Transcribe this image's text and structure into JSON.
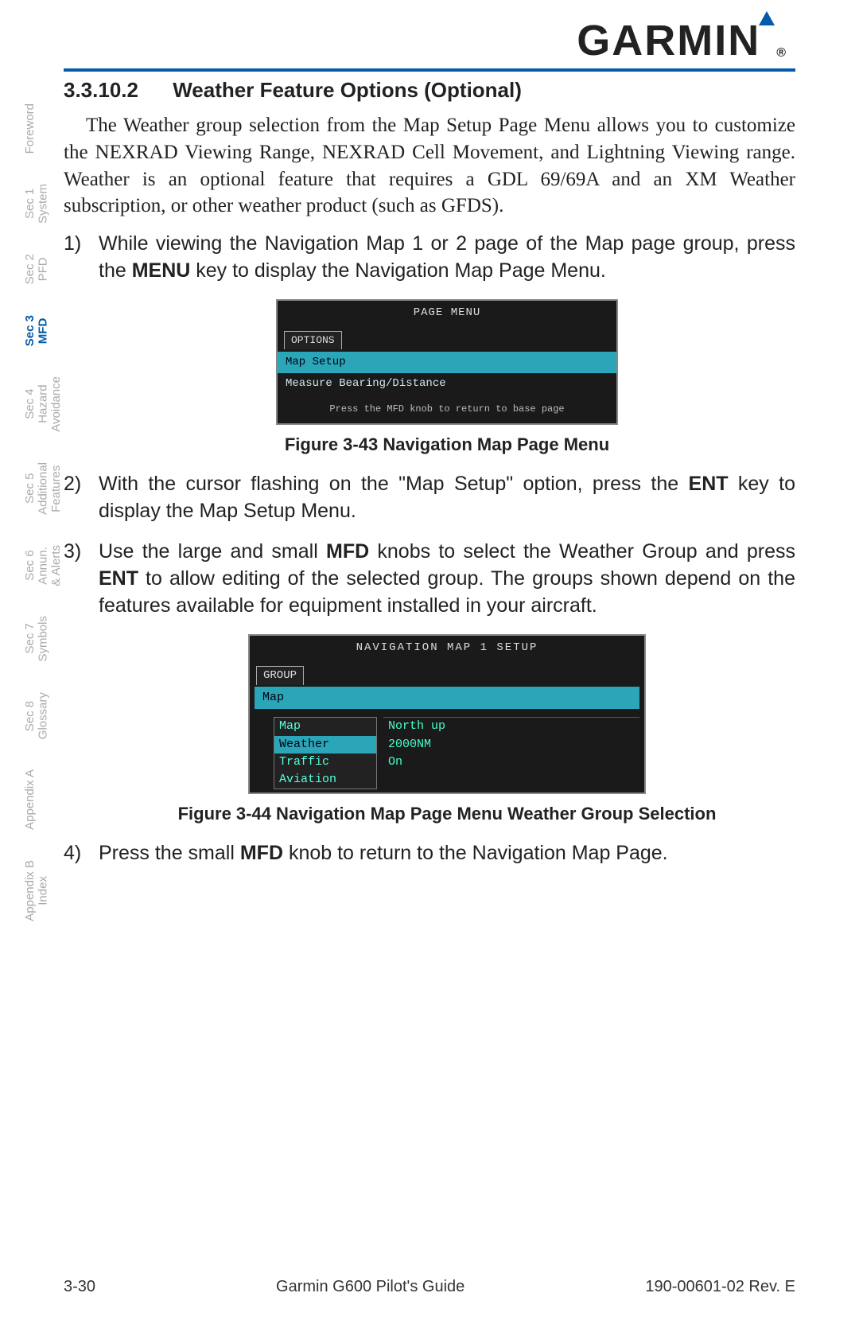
{
  "brand": {
    "name": "GARMIN",
    "reg": "®"
  },
  "heading": {
    "number": "3.3.10.2",
    "title": "Weather Feature Options (Optional)"
  },
  "intro": "The Weather group selection from the Map Setup Page Menu allows you to customize the NEXRAD Viewing Range, NEXRAD Cell Movement, and Lightning Viewing range. Weather is an optional feature that requires a GDL 69/69A and an XM Weather subscription, or other weather product (such as GFDS).",
  "steps": {
    "s1a": "While viewing the Navigation Map 1 or 2 page of the Map page group, press the ",
    "s1b": "MENU",
    "s1c": " key to display the Navigation Map Page Menu.",
    "s2a": "With the cursor flashing on the \"Map Setup\" option, press the ",
    "s2b": "ENT",
    "s2c": " key to display the Map Setup Menu.",
    "s3a": "Use the large and small ",
    "s3b": "MFD",
    "s3c": " knobs to select the Weather Group and press ",
    "s3d": "ENT",
    "s3e": " to allow editing of the selected group. The groups shown depend on the features available for equipment installed in your aircraft.",
    "s4a": "Press the small ",
    "s4b": "MFD",
    "s4c": " knob to return to the Navigation Map Page."
  },
  "fig1": {
    "caption": "Figure 3-43 Navigation Map Page Menu",
    "title": "PAGE MENU",
    "tab": "OPTIONS",
    "opt_selected": "Map Setup",
    "opt_other": "Measure Bearing/Distance",
    "hint": "Press the MFD knob to return to base page"
  },
  "fig2": {
    "caption": "Figure 3-44  Navigation Map Page Menu Weather Group Selection",
    "title": "NAVIGATION MAP 1 SETUP",
    "tab": "GROUP",
    "field": "Map",
    "dropdown": [
      "Map",
      "Weather",
      "Traffic",
      "Aviation"
    ],
    "dropdown_selected_index": 1,
    "values": [
      "North up",
      "2000NM",
      "On"
    ]
  },
  "sidetabs": [
    {
      "label": "Foreword",
      "active": false
    },
    {
      "label": "Sec 1\nSystem",
      "active": false
    },
    {
      "label": "Sec 2\nPFD",
      "active": false
    },
    {
      "label": "Sec 3\nMFD",
      "active": true
    },
    {
      "label": "Sec 4\nHazard\nAvoidance",
      "active": false
    },
    {
      "label": "Sec 5\nAdditional\nFeatures",
      "active": false
    },
    {
      "label": "Sec 6\nAnnun.\n& Alerts",
      "active": false
    },
    {
      "label": "Sec 7\nSymbols",
      "active": false
    },
    {
      "label": "Sec 8\nGlossary",
      "active": false
    },
    {
      "label": "Appendix A",
      "active": false
    },
    {
      "label": "Appendix B\nIndex",
      "active": false
    }
  ],
  "footer": {
    "page": "3-30",
    "center": "Garmin G600 Pilot's Guide",
    "right": "190-00601-02  Rev. E"
  }
}
